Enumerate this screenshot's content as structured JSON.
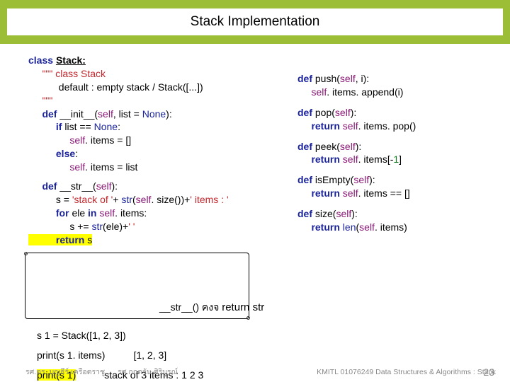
{
  "title": "Stack Implementation",
  "left": {
    "l1a": "class ",
    "l1b": "Stack:",
    "l2a": "     \"\"\" class Stack",
    "l3": "           default : empty stack / Stack([...])",
    "l4": "     \"\"\"",
    "l5a": "     def ",
    "l5b": "__init__(",
    "l5c": "self",
    "l5d": ", list = ",
    "l5e": "None",
    "l5f": "):",
    "l6a": "          if ",
    "l6b": "list == ",
    "l6c": "None",
    "l6d": ":",
    "l7a": "               self",
    "l7b": ". items = []",
    "l8a": "          else",
    "l8b": ":",
    "l9a": "               self",
    "l9b": ". items = list",
    "l10a": "     def ",
    "l10b": "__str__(",
    "l10c": "self",
    "l10d": "):",
    "l11a": "          s = ",
    "l11b": "'stack of '",
    "l11c": "+ ",
    "l11d": "str",
    "l11e": "(",
    "l11f": "self",
    "l11g": ". size())+",
    "l11h": "' items : '",
    "l12a": "          for ",
    "l12b": "ele ",
    "l12c": "in ",
    "l12d": "self",
    "l12e": ". items:",
    "l13a": "               s += ",
    "l13b": "str",
    "l13c": "(ele)+",
    "l13d": "' '",
    "l14a": "          return ",
    "l14b": "s"
  },
  "right": {
    "r1a": "def ",
    "r1b": "push(",
    "r1c": "self",
    "r1d": ", i):",
    "r2a": "     self",
    "r2b": ". items. append(i)",
    "r3a": "def ",
    "r3b": "pop(",
    "r3c": "self",
    "r3d": "):",
    "r4a": "     return ",
    "r4b": "self",
    "r4c": ". items. pop()",
    "r5a": "def ",
    "r5b": "peek(",
    "r5c": "self",
    "r5d": "):",
    "r6a": "     return ",
    "r6b": "self",
    "r6c": ". items[-",
    "r6d": "1",
    "r6e": "]",
    "r7a": "def ",
    "r7b": "isEmpty(",
    "r7c": "self",
    "r7d": "):",
    "r8a": "     return ",
    "r8b": "self",
    "r8c": ". items == []",
    "r9a": "def ",
    "r9b": "size(",
    "r9c": "self",
    "r9d": "):",
    "r10a": "     return ",
    "r10b": "len",
    "r10c": "(",
    "r10d": "self",
    "r10e": ". items)"
  },
  "callout": {
    "a": "__str__() ",
    "b": "คงจ    ",
    "c": "return str"
  },
  "examples": {
    "e1": "s 1 = Stack([1, 2, 3])",
    "e2": "print(s 1. items)",
    "o2": "[1, 2, 3]",
    "e3": "print(s 1)",
    "o3": "stack of 3 items : 1 2 3"
  },
  "footer": {
    "left1": "รศ.ดร. บุญธีร์     เครือตราชู",
    "left2": "รศ.กฤตวัน    ศิริบูรณ์",
    "right": "KMITL    01076249 Data Structures & Algorithms : Stack"
  },
  "page": "23"
}
